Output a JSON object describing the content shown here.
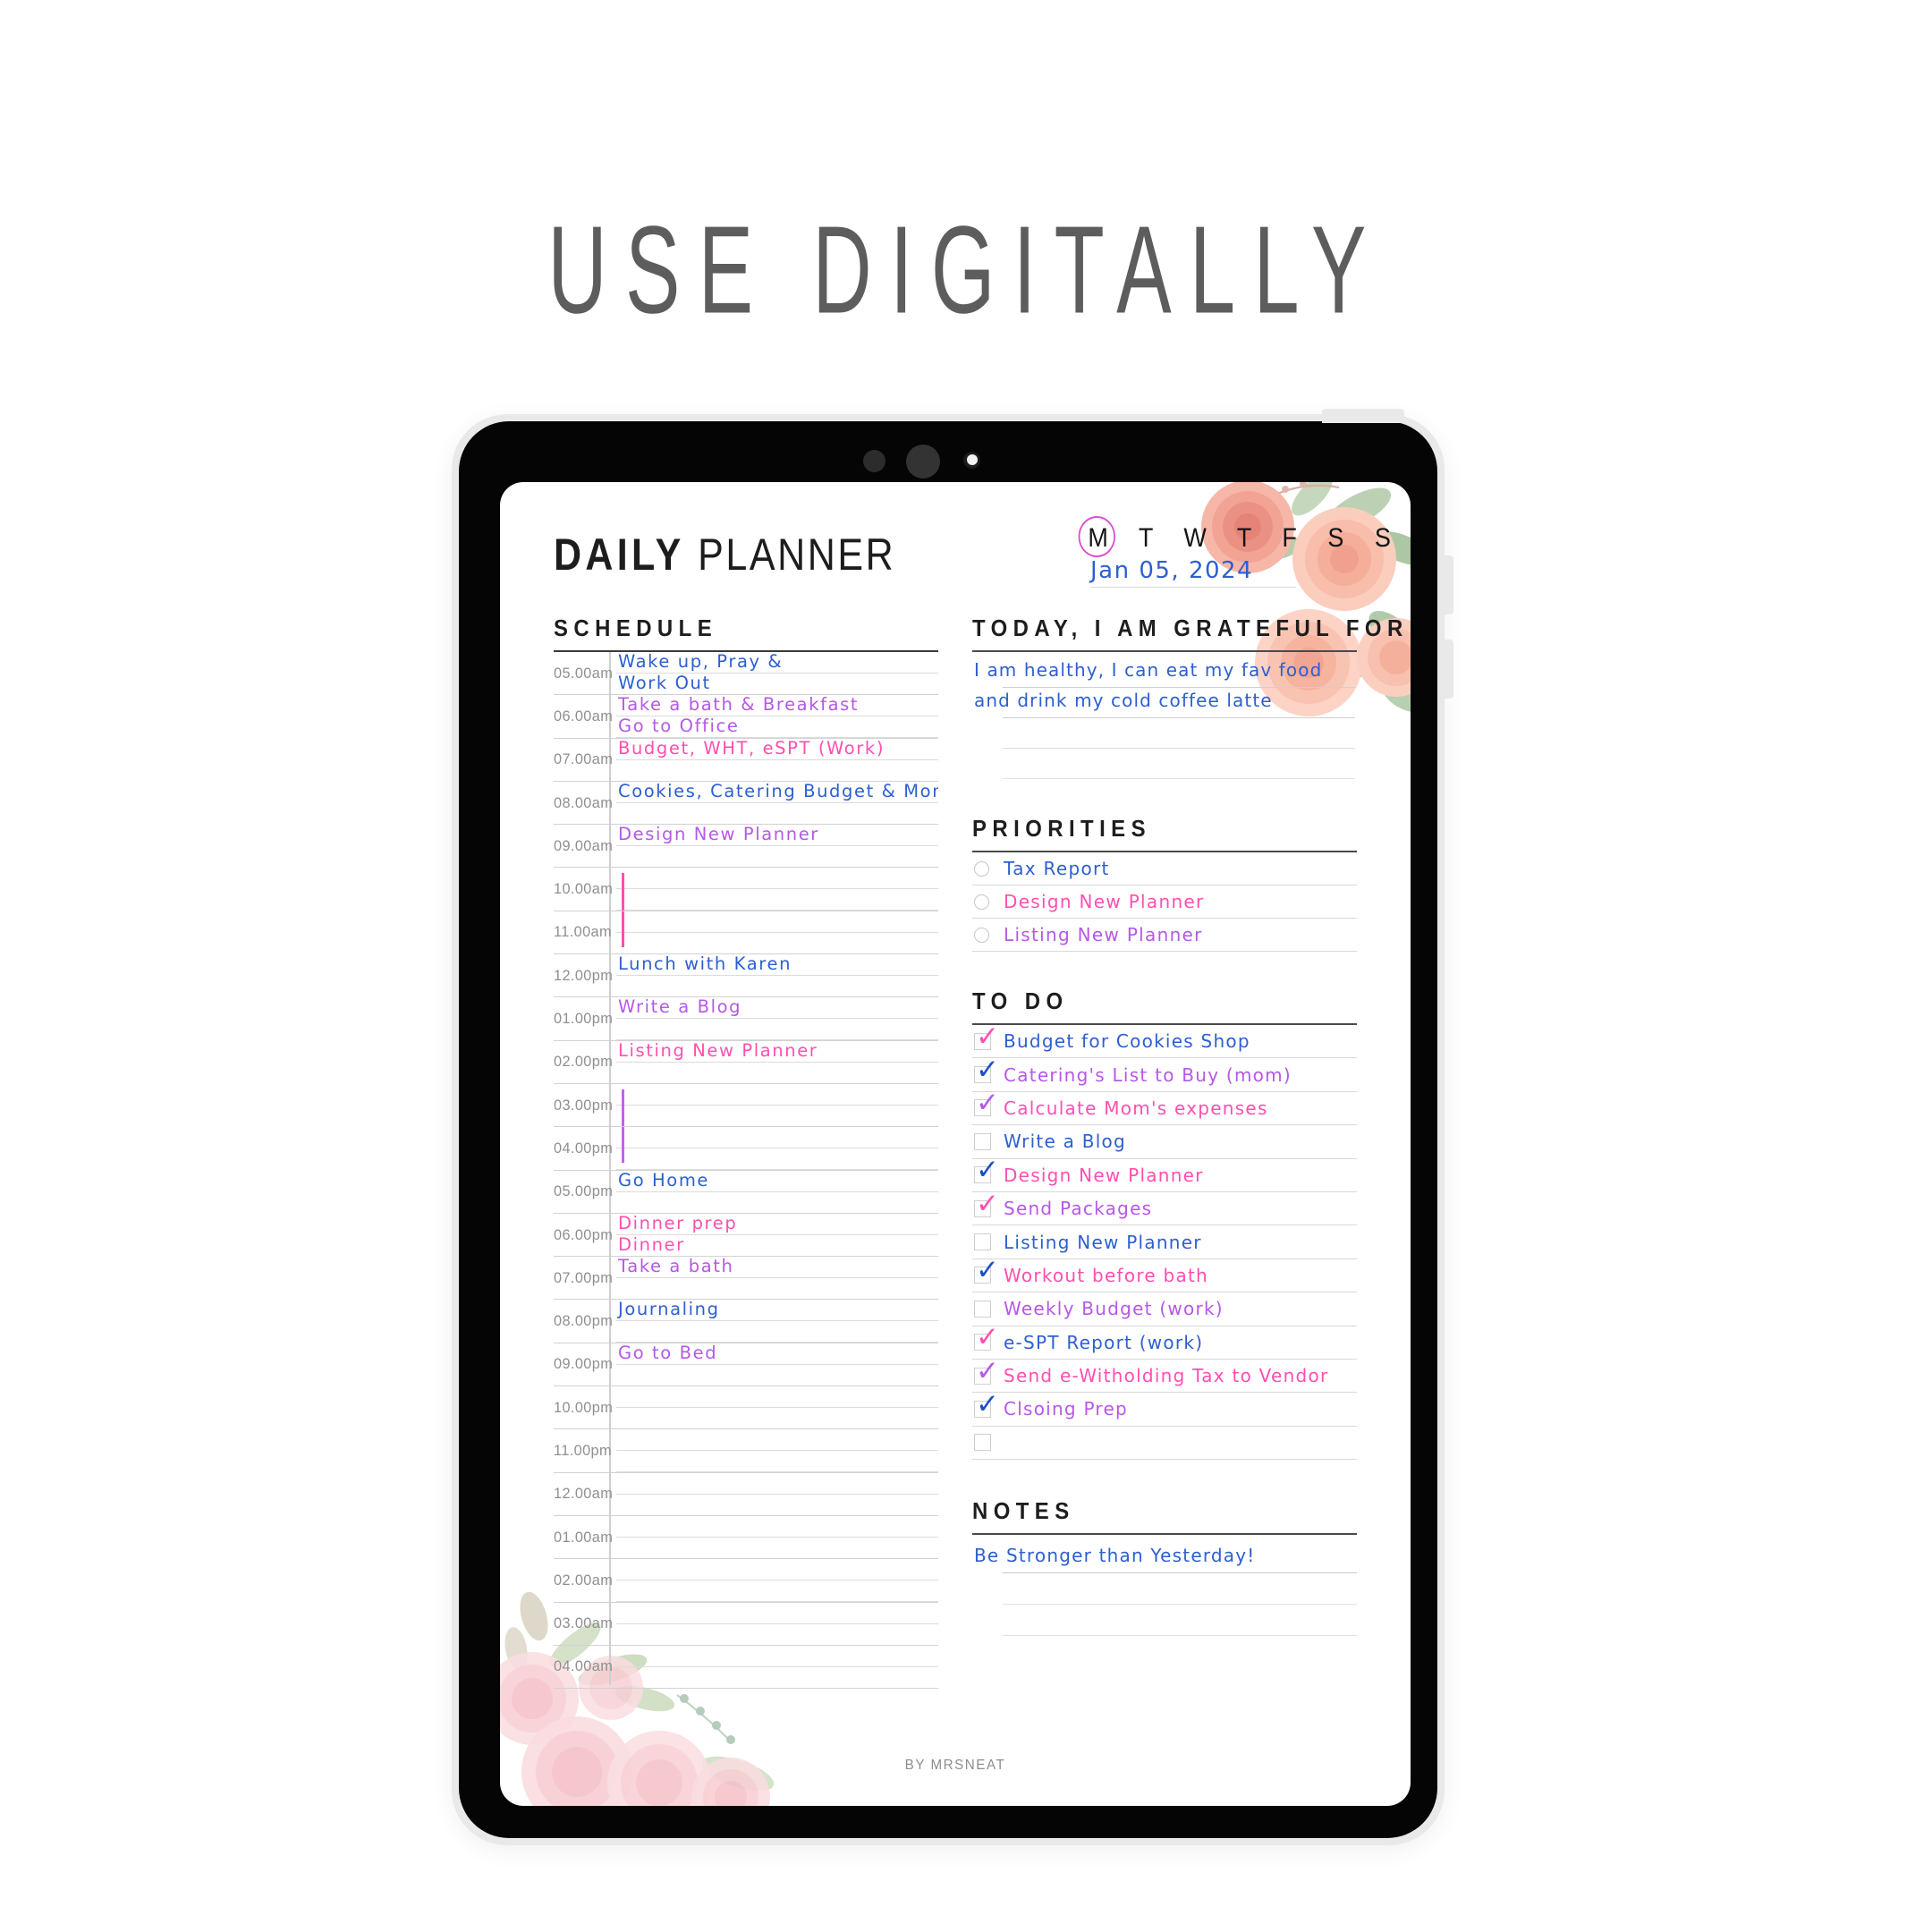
{
  "headline": "USE DIGITALLY",
  "planner": {
    "title_bold": "DAILY",
    "title_light": "PLANNER",
    "days": "M T W T F S S",
    "active_day": "M",
    "date": "Jan 05, 2024",
    "byline": "BY MRSNEAT",
    "colors": {
      "blue": "#2d5fd1",
      "purple": "#b558e8",
      "pink": "#ff4fb0",
      "magenta": "#d94fd0",
      "gray_text": "#8f8f8f",
      "rule": "#d2d2d2"
    },
    "schedule": {
      "heading": "SCHEDULE",
      "rows": [
        {
          "time": "05.00am",
          "line1": "Wake up, Pray &",
          "line1_color": "#2d5fd1",
          "line2": "Work Out",
          "line2_color": "#2d5fd1"
        },
        {
          "time": "06.00am",
          "line1": "Take a bath & Breakfast",
          "line1_color": "#b558e8",
          "line2": "Go to Office",
          "line2_color": "#b558e8"
        },
        {
          "time": "07.00am",
          "line1": "Budget, WHT, eSPT (Work)",
          "line1_color": "#ff4fb0",
          "line2": "",
          "line2_color": ""
        },
        {
          "time": "08.00am",
          "line1": "Cookies, Catering Budget & Mom'",
          "line1_color": "#2d5fd1",
          "line2": "",
          "line2_color": ""
        },
        {
          "time": "09.00am",
          "line1": "Design New Planner",
          "line1_color": "#b558e8",
          "line2": "",
          "line2_color": ""
        },
        {
          "time": "10.00am",
          "line1": "",
          "line1_color": "",
          "line2": "",
          "line2_color": "",
          "bar": "#ff4fb0",
          "bar_start": true
        },
        {
          "time": "11.00am",
          "line1": "",
          "line1_color": "",
          "line2": "",
          "line2_color": "",
          "bar": "#ff4fb0",
          "bar_end": true
        },
        {
          "time": "12.00pm",
          "line1": "Lunch with Karen",
          "line1_color": "#2d5fd1",
          "line2": "",
          "line2_color": ""
        },
        {
          "time": "01.00pm",
          "line1": "Write a Blog",
          "line1_color": "#b558e8",
          "line2": "",
          "line2_color": ""
        },
        {
          "time": "02.00pm",
          "line1": "Listing New Planner",
          "line1_color": "#ff4fb0",
          "line2": "",
          "line2_color": ""
        },
        {
          "time": "03.00pm",
          "line1": "",
          "line1_color": "",
          "line2": "",
          "line2_color": "",
          "bar": "#c860e8",
          "bar_start": true
        },
        {
          "time": "04.00pm",
          "line1": "",
          "line1_color": "",
          "line2": "",
          "line2_color": "",
          "bar": "#c860e8",
          "bar_end": true
        },
        {
          "time": "05.00pm",
          "line1": "Go Home",
          "line1_color": "#2d5fd1",
          "line2": "",
          "line2_color": ""
        },
        {
          "time": "06.00pm",
          "line1": "Dinner prep",
          "line1_color": "#ff4fb0",
          "line2": "Dinner",
          "line2_color": "#ff4fb0"
        },
        {
          "time": "07.00pm",
          "line1": "Take a bath",
          "line1_color": "#b558e8",
          "line2": "",
          "line2_color": ""
        },
        {
          "time": "08.00pm",
          "line1": "Journaling",
          "line1_color": "#2d5fd1",
          "line2": "",
          "line2_color": ""
        },
        {
          "time": "09.00pm",
          "line1": "Go to Bed",
          "line1_color": "#b558e8",
          "line2": "",
          "line2_color": ""
        },
        {
          "time": "10.00pm",
          "line1": "",
          "line1_color": "",
          "line2": "",
          "line2_color": ""
        },
        {
          "time": "11.00pm",
          "line1": "",
          "line1_color": "",
          "line2": "",
          "line2_color": ""
        },
        {
          "time": "12.00am",
          "line1": "",
          "line1_color": "",
          "line2": "",
          "line2_color": ""
        },
        {
          "time": "01.00am",
          "line1": "",
          "line1_color": "",
          "line2": "",
          "line2_color": ""
        },
        {
          "time": "02.00am",
          "line1": "",
          "line1_color": "",
          "line2": "",
          "line2_color": ""
        },
        {
          "time": "03.00am",
          "line1": "",
          "line1_color": "",
          "line2": "",
          "line2_color": ""
        },
        {
          "time": "04.00am",
          "line1": "",
          "line1_color": "",
          "line2": "",
          "line2_color": ""
        }
      ]
    },
    "grateful": {
      "heading": "TODAY, I AM GRATEFUL FOR",
      "lines": [
        "I am healthy, I can eat my fav food",
        "and drink my cold coffee latte",
        "",
        ""
      ]
    },
    "priorities": {
      "heading": "PRIORITIES",
      "items": [
        {
          "text": "Tax Report",
          "color": "#2d5fd1"
        },
        {
          "text": "Design New Planner",
          "color": "#ff4fb0"
        },
        {
          "text": "Listing New Planner",
          "color": "#b558e8"
        }
      ]
    },
    "todo": {
      "heading": "TO DO",
      "items": [
        {
          "text": "Budget for Cookies Shop",
          "color": "#2d5fd1",
          "checked": true,
          "check_color": "#ff4fb0"
        },
        {
          "text": "Catering's List to Buy (mom)",
          "color": "#b558e8",
          "checked": true,
          "check_color": "#1b4fc4"
        },
        {
          "text": "Calculate Mom's expenses",
          "color": "#ff4fb0",
          "checked": true,
          "check_color": "#b558e8"
        },
        {
          "text": "Write a Blog",
          "color": "#2d5fd1",
          "checked": false,
          "check_color": ""
        },
        {
          "text": "Design New Planner",
          "color": "#ff4fb0",
          "checked": true,
          "check_color": "#1b4fc4"
        },
        {
          "text": "Send Packages",
          "color": "#b558e8",
          "checked": true,
          "check_color": "#ff4fb0"
        },
        {
          "text": "Listing New Planner",
          "color": "#2d5fd1",
          "checked": false,
          "check_color": ""
        },
        {
          "text": "Workout before bath",
          "color": "#ff4fb0",
          "checked": true,
          "check_color": "#1b4fc4"
        },
        {
          "text": "Weekly Budget (work)",
          "color": "#b558e8",
          "checked": false,
          "check_color": ""
        },
        {
          "text": "e-SPT Report (work)",
          "color": "#2d5fd1",
          "checked": true,
          "check_color": "#ff4fb0"
        },
        {
          "text": "Send e-Witholding Tax to Vendor",
          "color": "#ff4fb0",
          "checked": true,
          "check_color": "#b558e8"
        },
        {
          "text": "Clsoing Prep",
          "color": "#b558e8",
          "checked": true,
          "check_color": "#1b4fc4"
        },
        {
          "text": "",
          "color": "",
          "checked": false,
          "check_color": ""
        }
      ]
    },
    "notes": {
      "heading": "NOTES",
      "lines": [
        "Be Stronger than Yesterday!",
        "",
        ""
      ]
    }
  }
}
